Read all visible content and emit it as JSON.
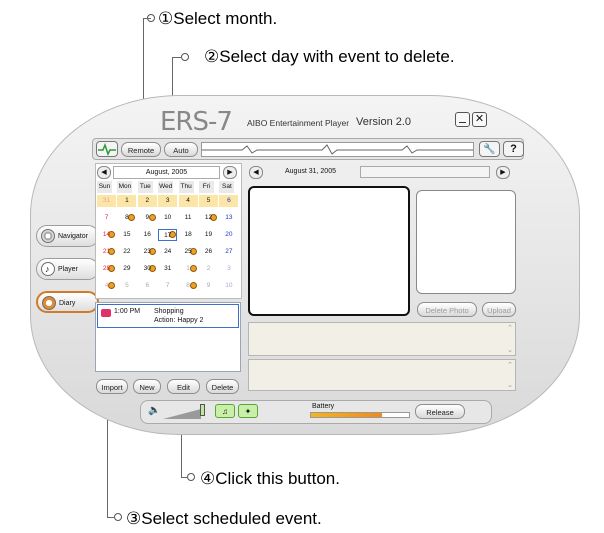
{
  "annotations": {
    "a1": "①Select month.",
    "a2": "②Select day with event to delete.",
    "a3": "③Select scheduled event.",
    "a4": "④Click this button."
  },
  "app": {
    "logo": "ERS-7",
    "title": "AIBO Entertainment Player",
    "version": "Version 2.0",
    "remote": "Remote",
    "auto": "Auto",
    "battery": "Battery",
    "battery_level_pct": 72,
    "release": "Release"
  },
  "sidebar": {
    "items": [
      {
        "label": "Navigator"
      },
      {
        "label": "Player"
      },
      {
        "label": "Diary"
      }
    ]
  },
  "calendar": {
    "month": "August, 2005",
    "weekdays": [
      "Sun",
      "Mon",
      "Tue",
      "Wed",
      "Thu",
      "Fri",
      "Sat"
    ],
    "rows": [
      [
        "31",
        "1",
        "2",
        "3",
        "4",
        "5",
        "6"
      ],
      [
        "7",
        "8",
        "9",
        "10",
        "11",
        "12",
        "13"
      ],
      [
        "14",
        "15",
        "16",
        "17",
        "18",
        "19",
        "20"
      ],
      [
        "21",
        "22",
        "23",
        "24",
        "25",
        "26",
        "27"
      ],
      [
        "28",
        "29",
        "30",
        "31",
        "1",
        "2",
        "3"
      ],
      [
        "4",
        "5",
        "6",
        "7",
        "8",
        "9",
        "10"
      ]
    ]
  },
  "event": {
    "time": "1:00 PM",
    "title": "Shopping",
    "action": "Action: Happy 2"
  },
  "buttons": {
    "import": "Import",
    "new": "New",
    "edit": "Edit",
    "delete": "Delete"
  },
  "right_panel": {
    "date": "August 31, 2005",
    "delete_photo": "Delete Photo",
    "upload": "Upload"
  }
}
